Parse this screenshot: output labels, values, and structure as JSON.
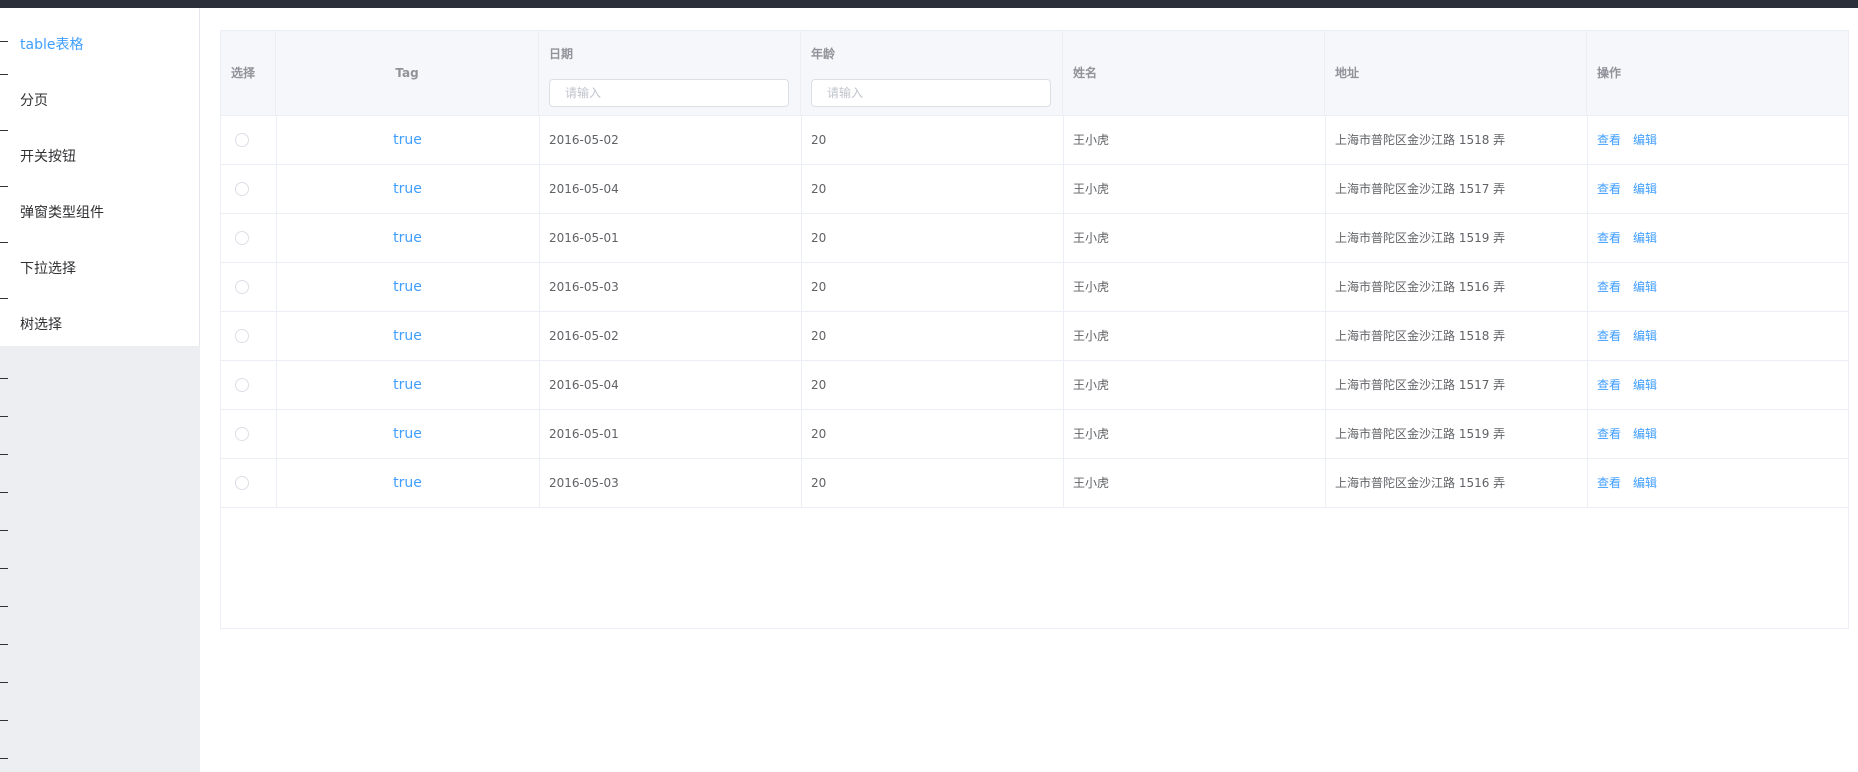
{
  "sidebar": {
    "items": [
      {
        "label": "table表格",
        "active": true
      },
      {
        "label": "分页"
      },
      {
        "label": "开关按钮"
      },
      {
        "label": "弹窗类型组件"
      },
      {
        "label": "下拉选择"
      },
      {
        "label": "树选择"
      }
    ]
  },
  "table": {
    "headers": {
      "select": "选择",
      "tag": "Tag",
      "date": "日期",
      "age": "年龄",
      "name": "姓名",
      "address": "地址",
      "actions": "操作"
    },
    "filters": {
      "date_placeholder": "请输入",
      "age_placeholder": "请输入"
    },
    "actions": {
      "view": "查看",
      "edit": "编辑"
    },
    "rows": [
      {
        "tag": "true",
        "date": "2016-05-02",
        "age": "20",
        "name": "王小虎",
        "address": "上海市普陀区金沙江路 1518 弄"
      },
      {
        "tag": "true",
        "date": "2016-05-04",
        "age": "20",
        "name": "王小虎",
        "address": "上海市普陀区金沙江路 1517 弄"
      },
      {
        "tag": "true",
        "date": "2016-05-01",
        "age": "20",
        "name": "王小虎",
        "address": "上海市普陀区金沙江路 1519 弄"
      },
      {
        "tag": "true",
        "date": "2016-05-03",
        "age": "20",
        "name": "王小虎",
        "address": "上海市普陀区金沙江路 1516 弄"
      },
      {
        "tag": "true",
        "date": "2016-05-02",
        "age": "20",
        "name": "王小虎",
        "address": "上海市普陀区金沙江路 1518 弄"
      },
      {
        "tag": "true",
        "date": "2016-05-04",
        "age": "20",
        "name": "王小虎",
        "address": "上海市普陀区金沙江路 1517 弄"
      },
      {
        "tag": "true",
        "date": "2016-05-01",
        "age": "20",
        "name": "王小虎",
        "address": "上海市普陀区金沙江路 1519 弄"
      },
      {
        "tag": "true",
        "date": "2016-05-03",
        "age": "20",
        "name": "王小虎",
        "address": "上海市普陀区金沙江路 1516 弄"
      }
    ]
  },
  "colors": {
    "accent": "#409eff",
    "text": "#606266",
    "header_bg": "#f5f7fa",
    "border": "#ebeef5",
    "topbar": "#2b2f3a"
  }
}
